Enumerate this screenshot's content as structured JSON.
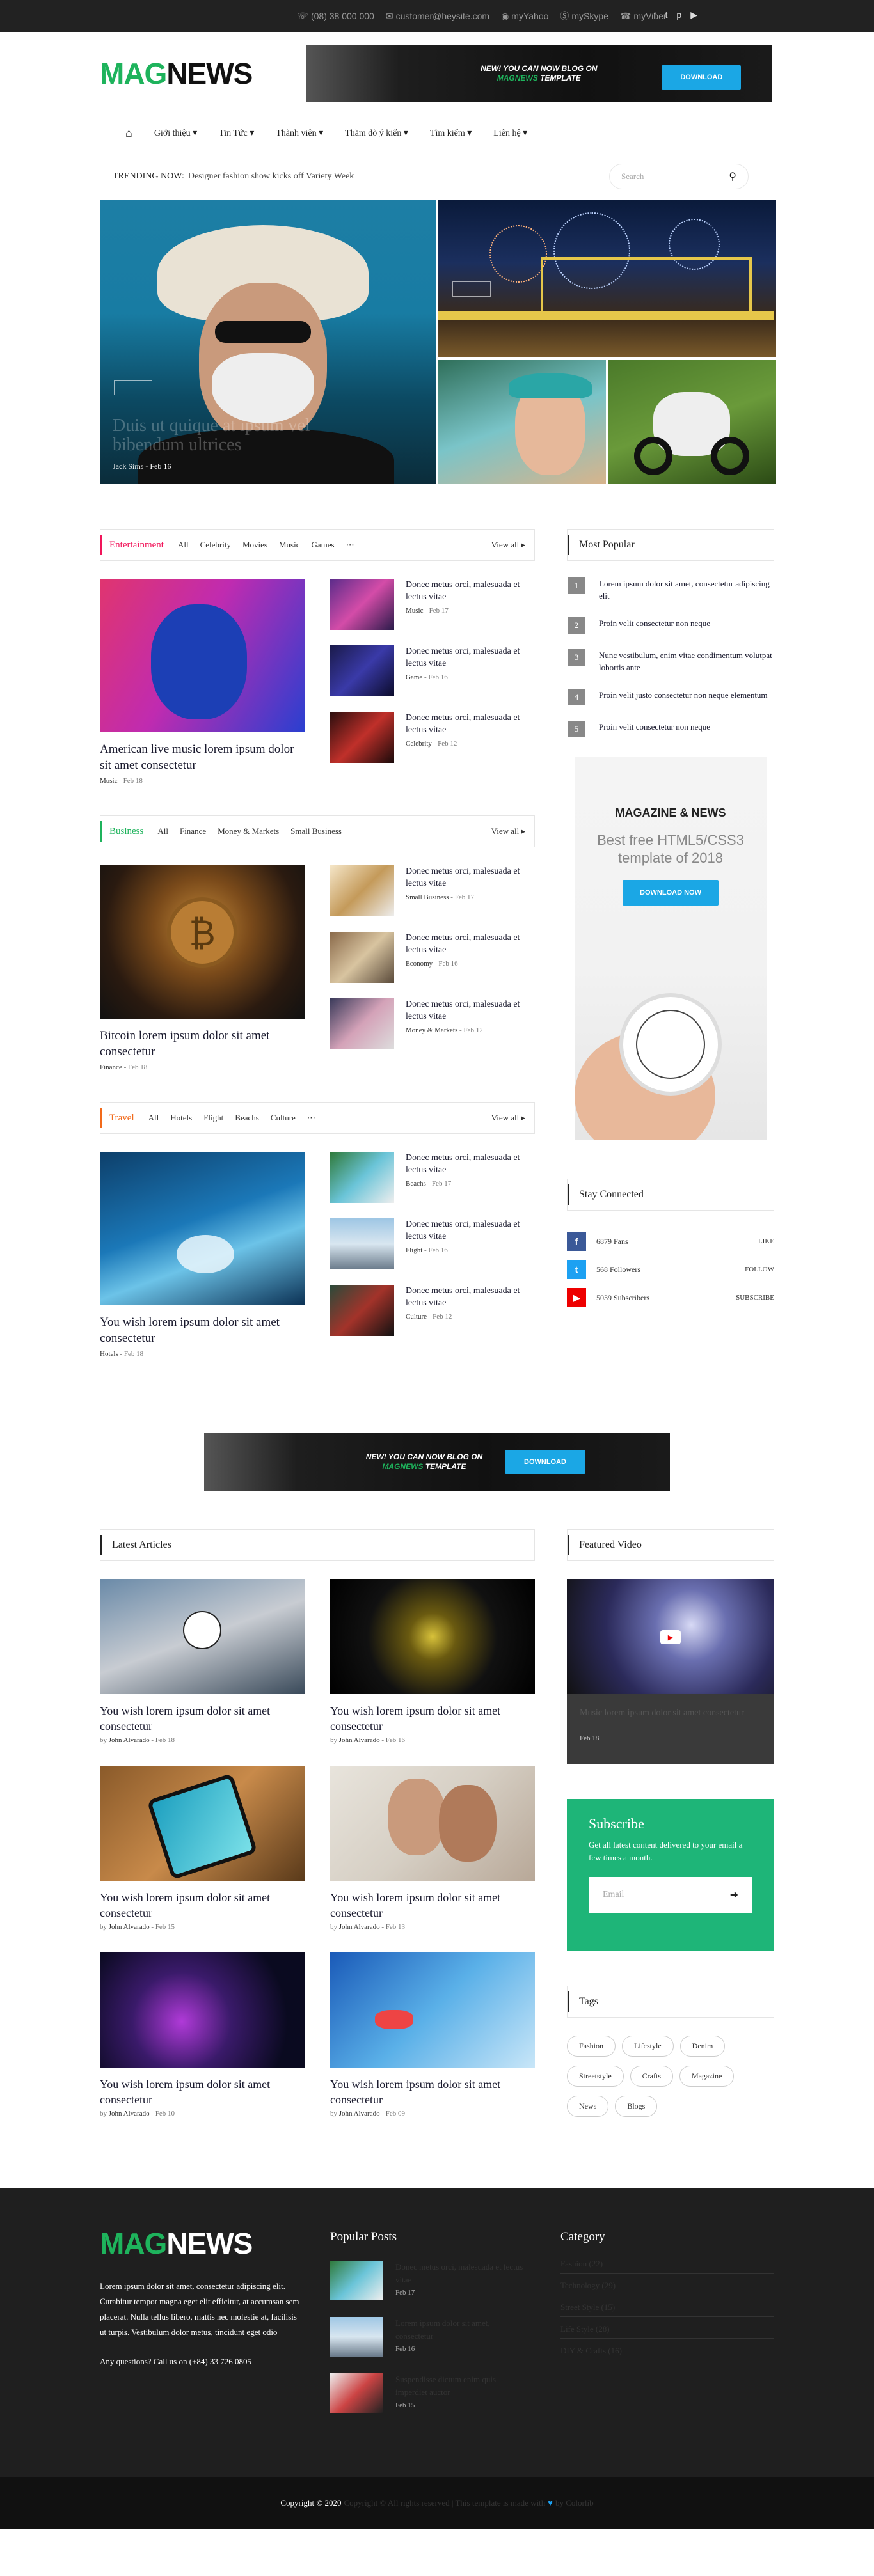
{
  "topbar": {
    "phone": "(08) 38 000 000",
    "email": "customer@heysite.com",
    "twitter": "myYahoo",
    "skype": "mySkype",
    "viber": "myViber",
    "social_icons": [
      "facebook-icon",
      "twitter-icon",
      "pinterest-icon",
      "youtube-icon"
    ]
  },
  "brand": {
    "part1": "MAG",
    "part2": "NEWS",
    "accent": "#1eb35c"
  },
  "header_banner": {
    "line1": "NEW! YOU CAN NOW BLOG ON",
    "line2a": "MAGNEWS",
    "line2b": " TEMPLATE",
    "button": "DOWNLOAD"
  },
  "nav": {
    "items": [
      "Giới thiệu",
      "Tin Tức",
      "Thành viên",
      "Thăm dò ý kiến",
      "Tìm kiếm",
      "Liên hệ"
    ]
  },
  "trending": {
    "label": "TRENDING NOW:",
    "text": "Designer fashion show kicks off Variety Week"
  },
  "search": {
    "placeholder": "Search"
  },
  "hero": {
    "title": "Duis ut quique at ipsum vel bibendum ultrices",
    "author": "Jack Sims",
    "date": "Feb 16"
  },
  "entertainment": {
    "title": "Entertainment",
    "color": "#f1155a",
    "tabs": [
      "All",
      "Celebrity",
      "Movies",
      "Music",
      "Games"
    ],
    "viewall": "View all",
    "main": {
      "title": "American live music lorem ipsum dolor sit amet consectetur",
      "cat": "Music",
      "date": "Feb 18"
    },
    "items": [
      {
        "title": "Donec metus orci, malesuada et lectus vitae",
        "cat": "Music",
        "date": "Feb 17"
      },
      {
        "title": "Donec metus orci, malesuada et lectus vitae",
        "cat": "Game",
        "date": "Feb 16"
      },
      {
        "title": "Donec metus orci, malesuada et lectus vitae",
        "cat": "Celebrity",
        "date": "Feb 12"
      }
    ]
  },
  "business": {
    "title": "Business",
    "color": "#1eb35c",
    "tabs": [
      "All",
      "Finance",
      "Money & Markets",
      "Small Business"
    ],
    "viewall": "View all",
    "main": {
      "title": "Bitcoin lorem ipsum dolor sit amet consectetur",
      "cat": "Finance",
      "date": "Feb 18"
    },
    "items": [
      {
        "title": "Donec metus orci, malesuada et lectus vitae",
        "cat": "Small Business",
        "date": "Feb 17"
      },
      {
        "title": "Donec metus orci, malesuada et lectus vitae",
        "cat": "Economy",
        "date": "Feb 16"
      },
      {
        "title": "Donec metus orci, malesuada et lectus vitae",
        "cat": "Money & Markets",
        "date": "Feb 12"
      }
    ]
  },
  "travel": {
    "title": "Travel",
    "color": "#f26a1b",
    "tabs": [
      "All",
      "Hotels",
      "Flight",
      "Beachs",
      "Culture"
    ],
    "viewall": "View all",
    "main": {
      "title": "You wish lorem ipsum dolor sit amet consectetur",
      "cat": "Hotels",
      "date": "Feb 18"
    },
    "items": [
      {
        "title": "Donec metus orci, malesuada et lectus vitae",
        "cat": "Beachs",
        "date": "Feb 17"
      },
      {
        "title": "Donec metus orci, malesuada et lectus vitae",
        "cat": "Flight",
        "date": "Feb 16"
      },
      {
        "title": "Donec metus orci, malesuada et lectus vitae",
        "cat": "Culture",
        "date": "Feb 12"
      }
    ]
  },
  "most_popular": {
    "title": "Most Popular",
    "items": [
      {
        "n": "1",
        "t": "Lorem ipsum dolor sit amet, consectetur adipiscing elit"
      },
      {
        "n": "2",
        "t": "Proin velit consectetur non neque"
      },
      {
        "n": "3",
        "t": "Nunc vestibulum, enim vitae condimentum volutpat lobortis ante"
      },
      {
        "n": "4",
        "t": "Proin velit justo consectetur non neque elementum"
      },
      {
        "n": "5",
        "t": "Proin velit consectetur non neque"
      }
    ]
  },
  "side_ad": {
    "headline": "MAGAZINE & NEWS",
    "sub1": "Best free HTML5/CSS3",
    "sub2": "template of 2018",
    "button": "DOWNLOAD NOW"
  },
  "stay": {
    "title": "Stay Connected",
    "items": [
      {
        "icon": "facebook-icon",
        "glyph": "f",
        "color": "#3b5998",
        "count": "6879 Fans",
        "action": "LIKE"
      },
      {
        "icon": "twitter-icon",
        "glyph": "t",
        "color": "#1da1f2",
        "count": "568 Followers",
        "action": "FOLLOW"
      },
      {
        "icon": "youtube-icon",
        "glyph": "▶",
        "color": "#e00",
        "count": "5039 Subscribers",
        "action": "SUBSCRIBE"
      }
    ]
  },
  "bottom_banner": {
    "line1": "NEW! YOU CAN NOW BLOG ON",
    "line2a": "MAGNEWS",
    "line2b": " TEMPLATE",
    "button": "DOWNLOAD"
  },
  "latest": {
    "title": "Latest Articles",
    "items": [
      {
        "title": "You wish lorem ipsum dolor sit amet consectetur",
        "author": "John Alvarado",
        "date": "Feb 18"
      },
      {
        "title": "You wish lorem ipsum dolor sit amet consectetur",
        "author": "John Alvarado",
        "date": "Feb 16"
      },
      {
        "title": "You wish lorem ipsum dolor sit amet consectetur",
        "author": "John Alvarado",
        "date": "Feb 15"
      },
      {
        "title": "You wish lorem ipsum dolor sit amet consectetur",
        "author": "John Alvarado",
        "date": "Feb 13"
      },
      {
        "title": "You wish lorem ipsum dolor sit amet consectetur",
        "author": "John Alvarado",
        "date": "Feb 10"
      },
      {
        "title": "You wish lorem ipsum dolor sit amet consectetur",
        "author": "John Alvarado",
        "date": "Feb 09"
      }
    ]
  },
  "featured_video": {
    "title": "Featured Video",
    "video_title": "Music lorem ipsum dolor sit amet consectetur",
    "date": "Feb 18"
  },
  "subscribe": {
    "title": "Subscribe",
    "text": "Get all latest content delivered to your email a few times a month.",
    "placeholder": "Email"
  },
  "tags": {
    "title": "Tags",
    "items": [
      "Fashion",
      "Lifestyle",
      "Denim",
      "Streetstyle",
      "Crafts",
      "Magazine",
      "News",
      "Blogs"
    ]
  },
  "footer": {
    "about": "Lorem ipsum dolor sit amet, consectetur adipiscing elit. Curabitur tempor magna eget elit efficitur, at accumsan sem placerat. Nulla tellus libero, mattis nec molestie at, facilisis ut turpis. Vestibulum dolor metus, tincidunt eget odio",
    "call": "Any questions? Call us on (+84) 33 726 0805",
    "popular_title": "Popular Posts",
    "posts": [
      {
        "title": "Donec metus orci, malesuada et lectus vitae",
        "date": "Feb 17"
      },
      {
        "title": "Lorem ipsum dolor sit amet, consectetur",
        "date": "Feb 16"
      },
      {
        "title": "Suspendisse dictum enim quis imperdiet auctor",
        "date": "Feb 15"
      }
    ],
    "category_title": "Category",
    "categories": [
      "Fashion (22)",
      "Technology (29)",
      "Street Style (15)",
      "Life Style (28)",
      "DIY & Crafts (16)"
    ]
  },
  "copyright": {
    "a": "Copyright © 2020",
    "b": "Copyright © All rights reserved | This template is made with",
    "c": "by Colorlib"
  }
}
